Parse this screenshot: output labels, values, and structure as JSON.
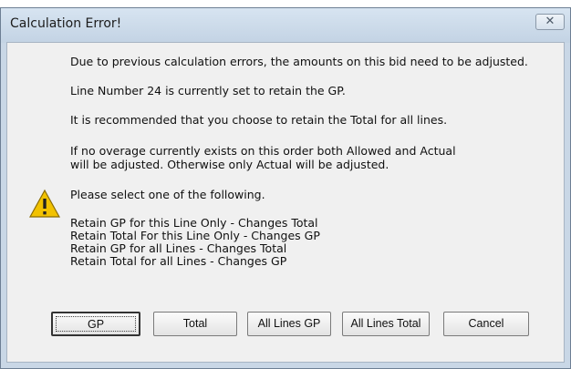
{
  "window": {
    "title": "Calculation Error!",
    "close_icon": "close-icon"
  },
  "message": {
    "lines": [
      "Due to previous calculation errors, the amounts on this bid need to be adjusted.",
      "Line Number 24 is currently set to retain the GP.",
      "It is recommended that you choose to retain the Total for all lines.",
      "If no overage currently exists on this order both Allowed and Actual",
      "will be adjusted.  Otherwise only Actual will be adjusted.",
      "Please select one of the following.",
      "Retain GP for this Line Only - Changes Total",
      "Retain Total For this Line Only - Changes GP",
      "Retain GP for all Lines - Changes Total",
      "Retain Total for all Lines - Changes GP"
    ],
    "icon": "warning-icon"
  },
  "buttons": {
    "gp": "GP",
    "total": "Total",
    "all_lines_gp": "All Lines GP",
    "all_lines_total": "All Lines Total",
    "cancel": "Cancel"
  }
}
